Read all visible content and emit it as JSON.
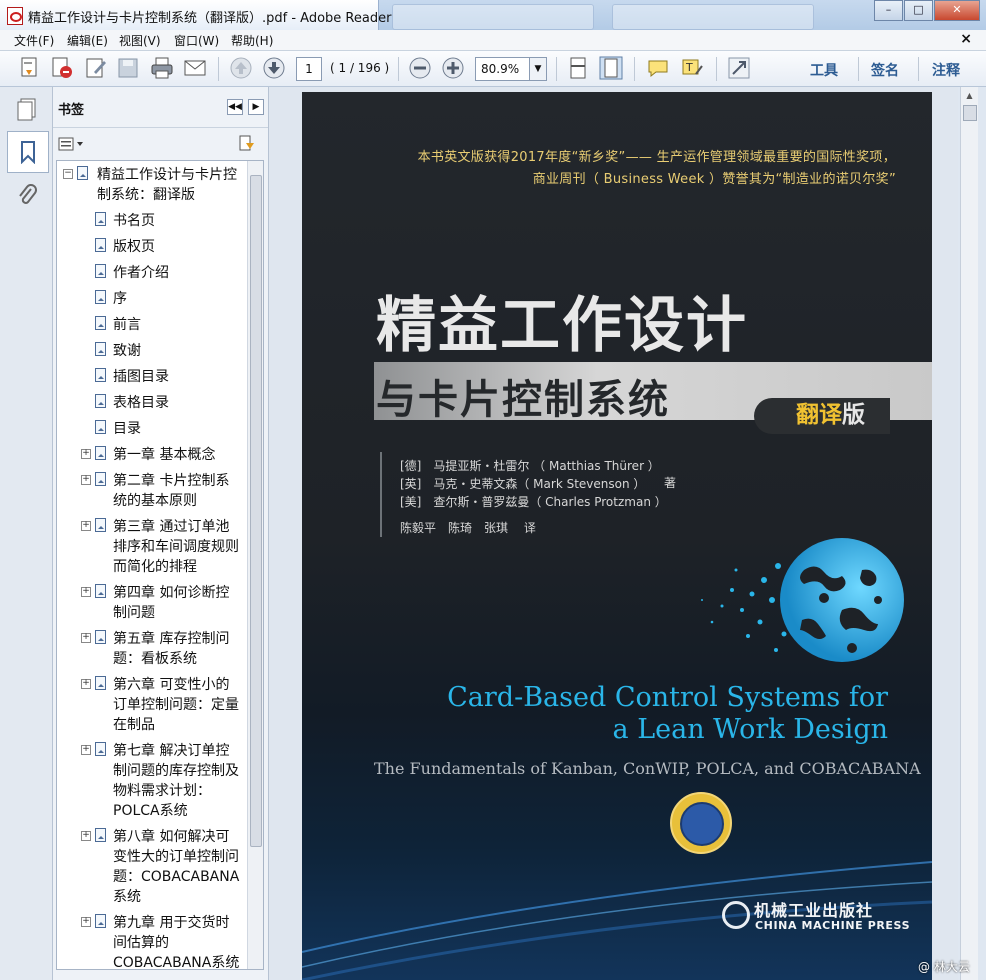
{
  "window": {
    "title": "精益工作设计与卡片控制系统（翻译版）.pdf - Adobe Reader",
    "min_btn": "–",
    "max_btn": "□",
    "close_btn": "✕"
  },
  "menu": {
    "items": [
      "文件(F)",
      "编辑(E)",
      "视图(V)",
      "窗口(W)",
      "帮助(H)"
    ],
    "close_doc": "×"
  },
  "toolbar": {
    "page_value": "1",
    "page_count": "( 1 / 196 )",
    "zoom_value": "80.9%",
    "links": [
      "工具",
      "签名",
      "注释"
    ]
  },
  "bookmarks": {
    "title": "书签",
    "items": [
      {
        "label": "精益工作设计与卡片控制系统：翻译版",
        "expand": "−"
      },
      {
        "label": "书名页"
      },
      {
        "label": "版权页"
      },
      {
        "label": "作者介绍"
      },
      {
        "label": "序"
      },
      {
        "label": "前言"
      },
      {
        "label": "致谢"
      },
      {
        "label": "插图目录"
      },
      {
        "label": "表格目录"
      },
      {
        "label": "目录"
      },
      {
        "label": "第一章 基本概念",
        "expand": "+"
      },
      {
        "label": "第二章 卡片控制系统的基本原则",
        "expand": "+"
      },
      {
        "label": "第三章 通过订单池排序和车间调度规则而简化的排程",
        "expand": "+"
      },
      {
        "label": "第四章 如何诊断控制问题",
        "expand": "+"
      },
      {
        "label": "第五章 库存控制问题：看板系统",
        "expand": "+"
      },
      {
        "label": "第六章 可变性小的订单控制问题：定量在制品",
        "expand": "+"
      },
      {
        "label": "第七章 解决订单控制问题的库存控制及物料需求计划：POLCA系统",
        "expand": "+"
      },
      {
        "label": "第八章 如何解决可变性大的订单控制问题：COBACABANA系统",
        "expand": "+"
      },
      {
        "label": "第九章 用于交货时间估算的COBACABANA系统",
        "expand": "+"
      }
    ]
  },
  "cover": {
    "award_line1": "本书英文版获得2017年度“新乡奖”—— 生产运作管理领域最重要的国际性奖项，",
    "award_line2": "商业周刊（ Business Week ）赞誉其为“制造业的诺贝尔奖”",
    "title_line1": "精益工作设计",
    "title_line2": "与卡片控制系统",
    "edition_a": "翻",
    "edition_b": "译",
    "edition_c": "版",
    "author1": "[德]　马提亚斯・杜雷尔 （ Matthias Thürer ）",
    "author2": "[英]　马克・史蒂文森（ Mark Stevenson ）",
    "author3": "[美]　查尔斯・普罗兹曼（ Charles Protzman ）",
    "zhu": "著",
    "translators": "陈毅平　陈琦　张琪　 译",
    "en_title_1": "Card-Based Control Systems for",
    "en_title_2": "a Lean Work Design",
    "en_subtitle": "The Fundamentals of Kanban, ConWIP, POLCA, and COBACABANA",
    "publisher_zh": "机械工业出版社",
    "publisher_en": "CHINA MACHINE PRESS"
  },
  "watermark": "@ 林大云"
}
